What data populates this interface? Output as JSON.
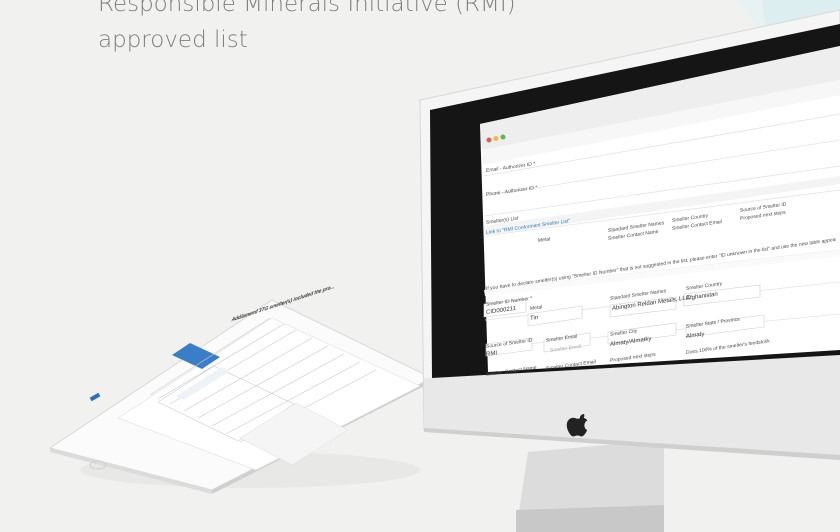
{
  "headline": {
    "line1": "Responsible Minerals Initiative (RMI)",
    "line2": "approved list"
  },
  "imac_screen": {
    "email_label": "Email - Authorizer ID *",
    "phone_label": "Phone - Authorizer ID *",
    "smelter_search": "Smelter(s) List",
    "link": "Link to \"RMI Conformant Smelter List\"",
    "column_metal": "Metal",
    "column_standard_name": "Standard Smelter Names",
    "column_country": "Smelter Country",
    "column_source_id": "Source of Smelter ID",
    "column_contact_name": "Smelter Contact Name",
    "column_contact_email": "Smelter Contact Email",
    "column_steps": "Proposed next steps",
    "instruction": "If you have to declare smelter(s) using \"Smelter ID Number\" that is not suggested in the list, please enter \"ID unknown in the list\" and use the new table appeared below to enter all the information about these smelter(s).",
    "smelter_id_label": "Smelter ID Number *",
    "smelter_id_value": "CID000211",
    "metal_label": "Metal",
    "metal_value": "Tin",
    "standard_names_label": "Standard Smelter Names",
    "standard_names_value": "Abington Reldan Metals, LLC",
    "country_label": "Smelter Country",
    "country_value": "Afghanistan",
    "source_label": "Source of Smelter ID",
    "source_value": "RMI",
    "email_label2": "Smelter Email",
    "email_placeholder": "Smelter Email",
    "city_label": "Smelter City",
    "city_value": "Almaty/Almatky",
    "state_label": "Smelter State / Province",
    "state_value": "Almaty",
    "contact_name_label": "Smelter Contact Name",
    "contact_email_label": "Smelter Contact Email",
    "next_steps_label": "Proposed next steps",
    "feedstock_label": "Does 100% of the smelter's feedstock"
  },
  "ipad_screen": {
    "title": "Add/amend 3TG smelter(s) included the pro..."
  }
}
